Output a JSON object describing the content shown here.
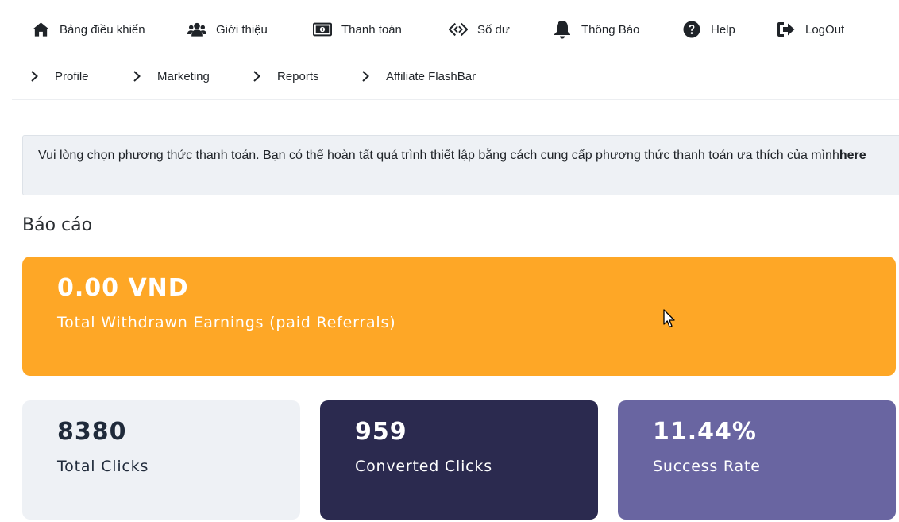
{
  "nav": {
    "primary": [
      {
        "label": "Bảng điều khiển",
        "icon": "home-icon"
      },
      {
        "label": "Giới thiệu",
        "icon": "users-icon"
      },
      {
        "label": "Thanh toán",
        "icon": "money-bill-icon"
      },
      {
        "label": "Số dư",
        "icon": "balance-icon"
      },
      {
        "label": "Thông Báo",
        "icon": "bell-icon"
      },
      {
        "label": "Help",
        "icon": "question-circle-icon"
      },
      {
        "label": "LogOut",
        "icon": "logout-icon"
      }
    ],
    "secondary": [
      {
        "label": "Profile",
        "icon": "chevron-right-icon"
      },
      {
        "label": "Marketing",
        "icon": "chevron-right-icon"
      },
      {
        "label": "Reports",
        "icon": "chevron-right-icon"
      },
      {
        "label": "Affiliate FlashBar",
        "icon": "chevron-right-icon"
      }
    ]
  },
  "alert": {
    "text": "Vui lòng chọn phương thức thanh toán. Bạn có thể hoàn tất quá trình thiết lập bằng cách cung cấp phương thức thanh toán ưa thích của mình",
    "link": "here"
  },
  "report": {
    "title": "Báo cáo",
    "withdrawn": {
      "value": "0.00 VND",
      "label": "Total Withdrawn Earnings (paid Referrals)",
      "color": "#fea726"
    },
    "total_clicks": {
      "value": "8380",
      "label": "Total Clicks",
      "color": "#eef1f5"
    },
    "converted_clicks": {
      "value": "959",
      "label": "Converted Clicks",
      "color": "#2b2a4f"
    },
    "success_rate": {
      "value": "11.44%",
      "label": "Success Rate",
      "color": "#6965a1"
    }
  }
}
